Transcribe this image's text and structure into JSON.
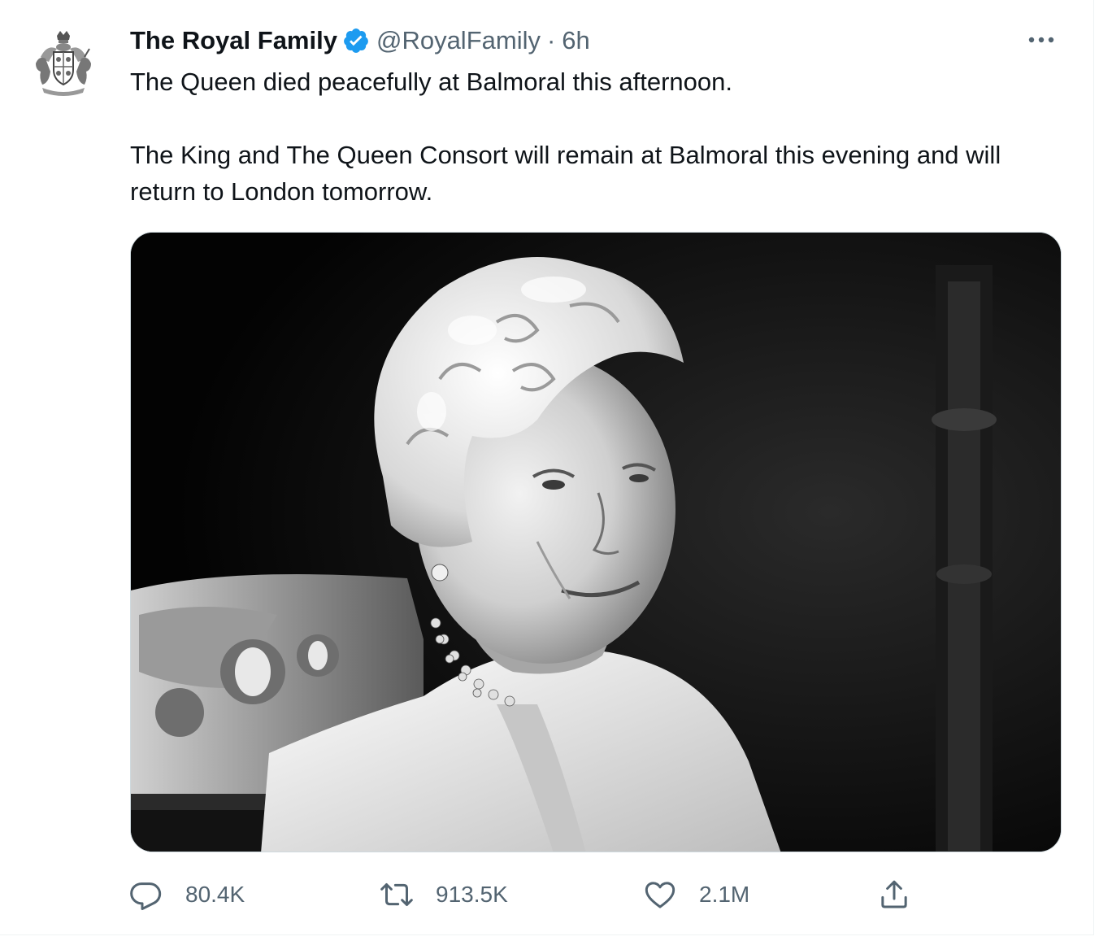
{
  "tweet": {
    "author": {
      "display_name": "The Royal Family",
      "handle": "@RoyalFamily",
      "separator": "·",
      "time": "6h",
      "verified_color": "#1d9bf0"
    },
    "text_lines": [
      "The Queen died peacefully at Balmoral this afternoon.",
      "The King and The Queen Consort will remain at Balmoral this evening and will return to London tomorrow."
    ],
    "media": {
      "kind": "black-and-white portrait photo"
    },
    "actions": {
      "reply_count": "80.4K",
      "retweet_count": "913.5K",
      "like_count": "2.1M",
      "icons": [
        "reply-icon",
        "retweet-icon",
        "like-icon",
        "share-icon"
      ]
    },
    "colors": {
      "text": "#0f1419",
      "secondary": "#536471",
      "border": "#cfd9de"
    }
  }
}
